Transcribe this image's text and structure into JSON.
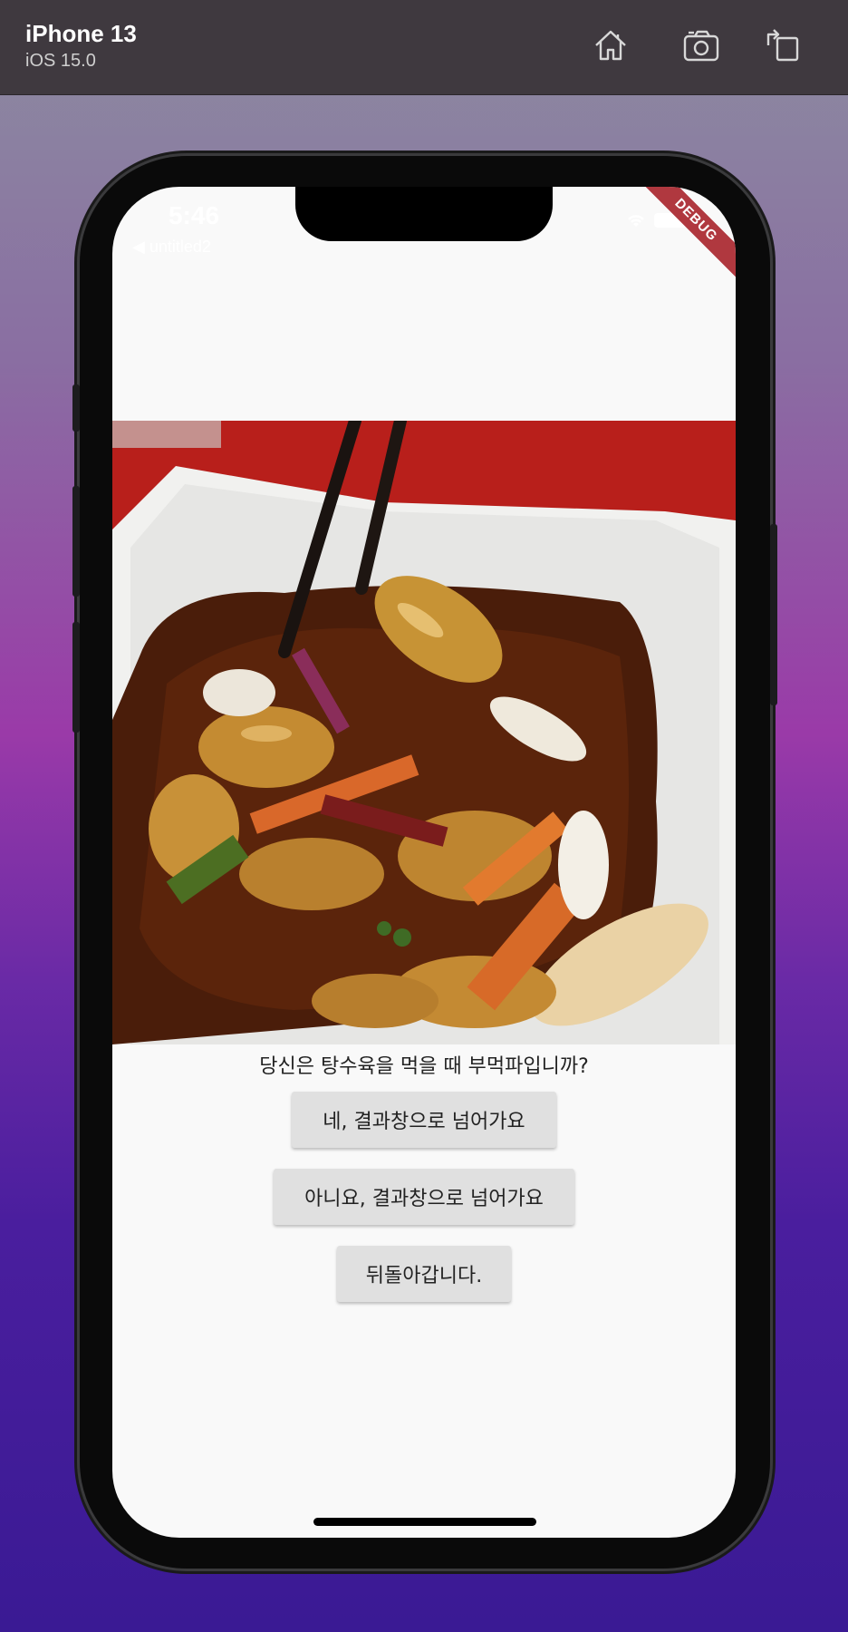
{
  "simulator": {
    "device_name": "iPhone 13",
    "os_version": "iOS 15.0",
    "toolbar_icons": [
      "home-icon",
      "screenshot-icon",
      "rotate-icon"
    ]
  },
  "status_bar": {
    "time": "5:46",
    "back_label": "◀ untitled2",
    "icons": [
      "wifi-icon",
      "battery-icon"
    ]
  },
  "debug_banner": "DEBUG",
  "content": {
    "question": "당신은 탕수육을 먹을 때 부먹파입니까?",
    "buttons": {
      "yes": "네, 결과창으로 넘어가요",
      "no": "아니요, 결과창으로 넘어가요",
      "back": "뒤돌아갑니다."
    }
  },
  "colors": {
    "toolbar": "#3f393f",
    "debug_ribbon": "#b0383f",
    "button_bg": "#e0e0e0",
    "screen_bg": "#f9f9f9"
  }
}
